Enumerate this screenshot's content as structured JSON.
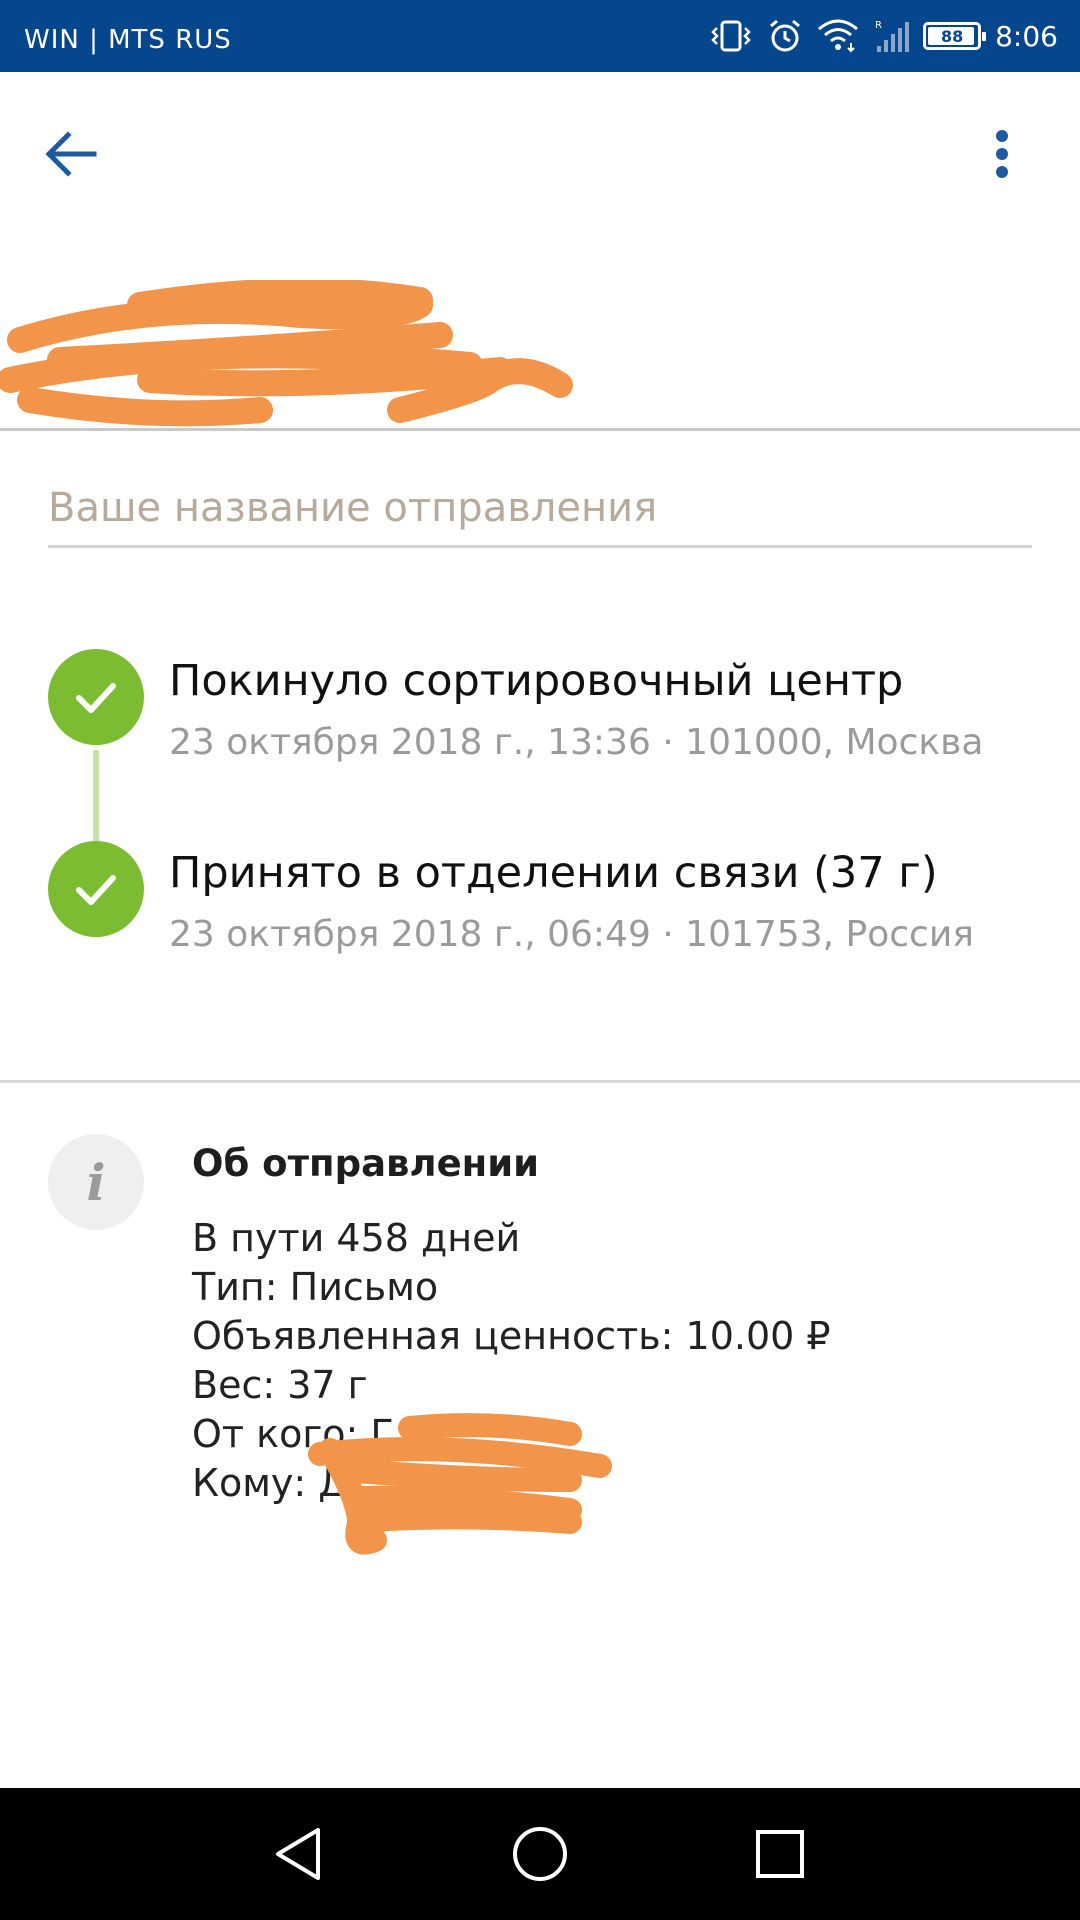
{
  "status_bar": {
    "carrier": "WIN | MTS RUS",
    "time": "8:06",
    "battery": "88",
    "icons": [
      "vibrate-icon",
      "alarm-icon",
      "wifi-icon",
      "roaming-signal-icon",
      "battery-icon"
    ]
  },
  "app_bar": {
    "back_icon": "arrow-left-icon",
    "menu_icon": "more-vertical-icon",
    "icon_color": "#1e5aa0"
  },
  "name_field": {
    "placeholder": "Ваше название отправления",
    "value": ""
  },
  "timeline": {
    "accent_color": "#7cbc30",
    "events": [
      {
        "title": "Покинуло сортировочный центр",
        "meta": "23 октября 2018 г., 13:36 · 101000, Москва"
      },
      {
        "title": "Принято в отделении связи (37 г)",
        "meta": "23 октября 2018 г., 06:49 · 101753, Россия"
      }
    ]
  },
  "info": {
    "icon": "info-icon",
    "heading": "Об отправлении",
    "lines": [
      "В пути 458 дней",
      "Тип: Письмо",
      "Объявленная ценность: 10.00 ₽",
      "Вес: 37 г",
      "От кого: Г",
      "Кому: Д"
    ]
  },
  "redaction_color": "#f2944a",
  "nav_bar": {
    "buttons": [
      "back-triangle-icon",
      "home-circle-icon",
      "recents-square-icon"
    ]
  }
}
